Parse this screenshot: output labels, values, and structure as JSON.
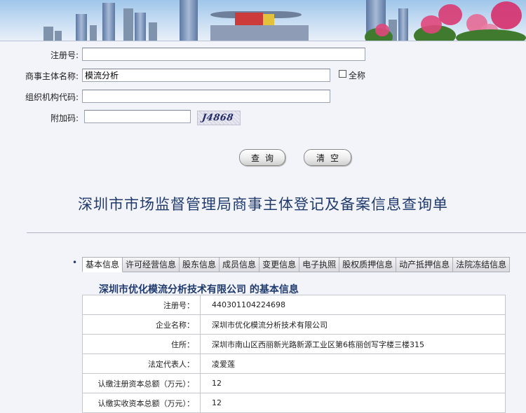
{
  "search": {
    "reg_no_label": "注册号:",
    "reg_no_value": "",
    "entity_name_label": "商事主体名称:",
    "entity_name_value": "模流分析",
    "full_name_label": "全称",
    "org_code_label": "组织机构代码:",
    "org_code_value": "",
    "extra_code_label": "附加码:",
    "extra_code_value": "",
    "captcha_text": "J4868",
    "query_button": "查询",
    "clear_button": "清空"
  },
  "report": {
    "title": "深圳市市场监督管理局商事主体登记及备案信息查询单",
    "bullet": "•",
    "tabs": [
      {
        "label": "基本信息",
        "active": true
      },
      {
        "label": "许可经营信息",
        "active": false
      },
      {
        "label": "股东信息",
        "active": false
      },
      {
        "label": "成员信息",
        "active": false
      },
      {
        "label": "变更信息",
        "active": false
      },
      {
        "label": "电子执照",
        "active": false
      },
      {
        "label": "股权质押信息",
        "active": false
      },
      {
        "label": "动产抵押信息",
        "active": false
      },
      {
        "label": "法院冻结信息",
        "active": false
      }
    ],
    "company_heading": "深圳市优化模流分析技术有限公司 的基本信息",
    "rows": [
      {
        "key": "注册号：",
        "value": "440301104224698"
      },
      {
        "key": "企业名称：",
        "value": "深圳市优化模流分析技术有限公司"
      },
      {
        "key": "住所：",
        "value": "深圳市南山区西丽新光路新源工业区第6栋丽创写字楼三楼315"
      },
      {
        "key": "法定代表人：",
        "value": "凌爱莲"
      },
      {
        "key": "认缴注册资本总额（万元）：",
        "value": "12"
      },
      {
        "key": "认缴实收资本总额（万元）：",
        "value": "12"
      }
    ]
  }
}
